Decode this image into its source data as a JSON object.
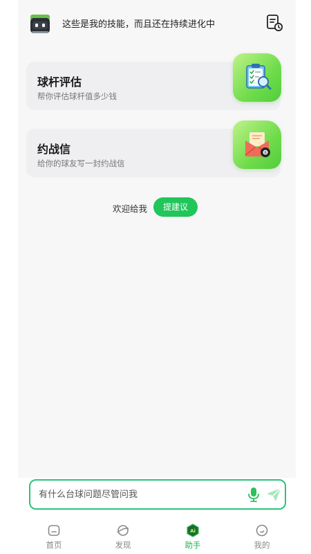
{
  "header": {
    "title": "这些是我的技能，而且还在持续进化中",
    "robot_icon": "robot-icon",
    "history_icon": "history-document-icon"
  },
  "skills": [
    {
      "title": "球杆评估",
      "description": "帮你评估球杆值多少钱",
      "icon": "clipboard-magnifier-icon"
    },
    {
      "title": "约战信",
      "description": "给你的球友写一封约战信",
      "icon": "envelope-billiard-ball-icon"
    }
  ],
  "suggest": {
    "text": "欢迎给我",
    "button_label": "提建议"
  },
  "input": {
    "placeholder": "有什么台球问题尽管问我",
    "mic_icon": "microphone-icon",
    "send_icon": "send-icon"
  },
  "tabs": [
    {
      "label": "首页",
      "icon": "home-icon",
      "active": false
    },
    {
      "label": "发现",
      "icon": "planet-icon",
      "active": false
    },
    {
      "label": "助手",
      "icon": "ai-hexagon-icon",
      "active": true
    },
    {
      "label": "我的",
      "icon": "profile-icon",
      "active": false
    }
  ],
  "colors": {
    "accent": "#20c65a",
    "background": "#f7f7f8",
    "card": "#efeff1",
    "input_border": "#29c37a"
  }
}
